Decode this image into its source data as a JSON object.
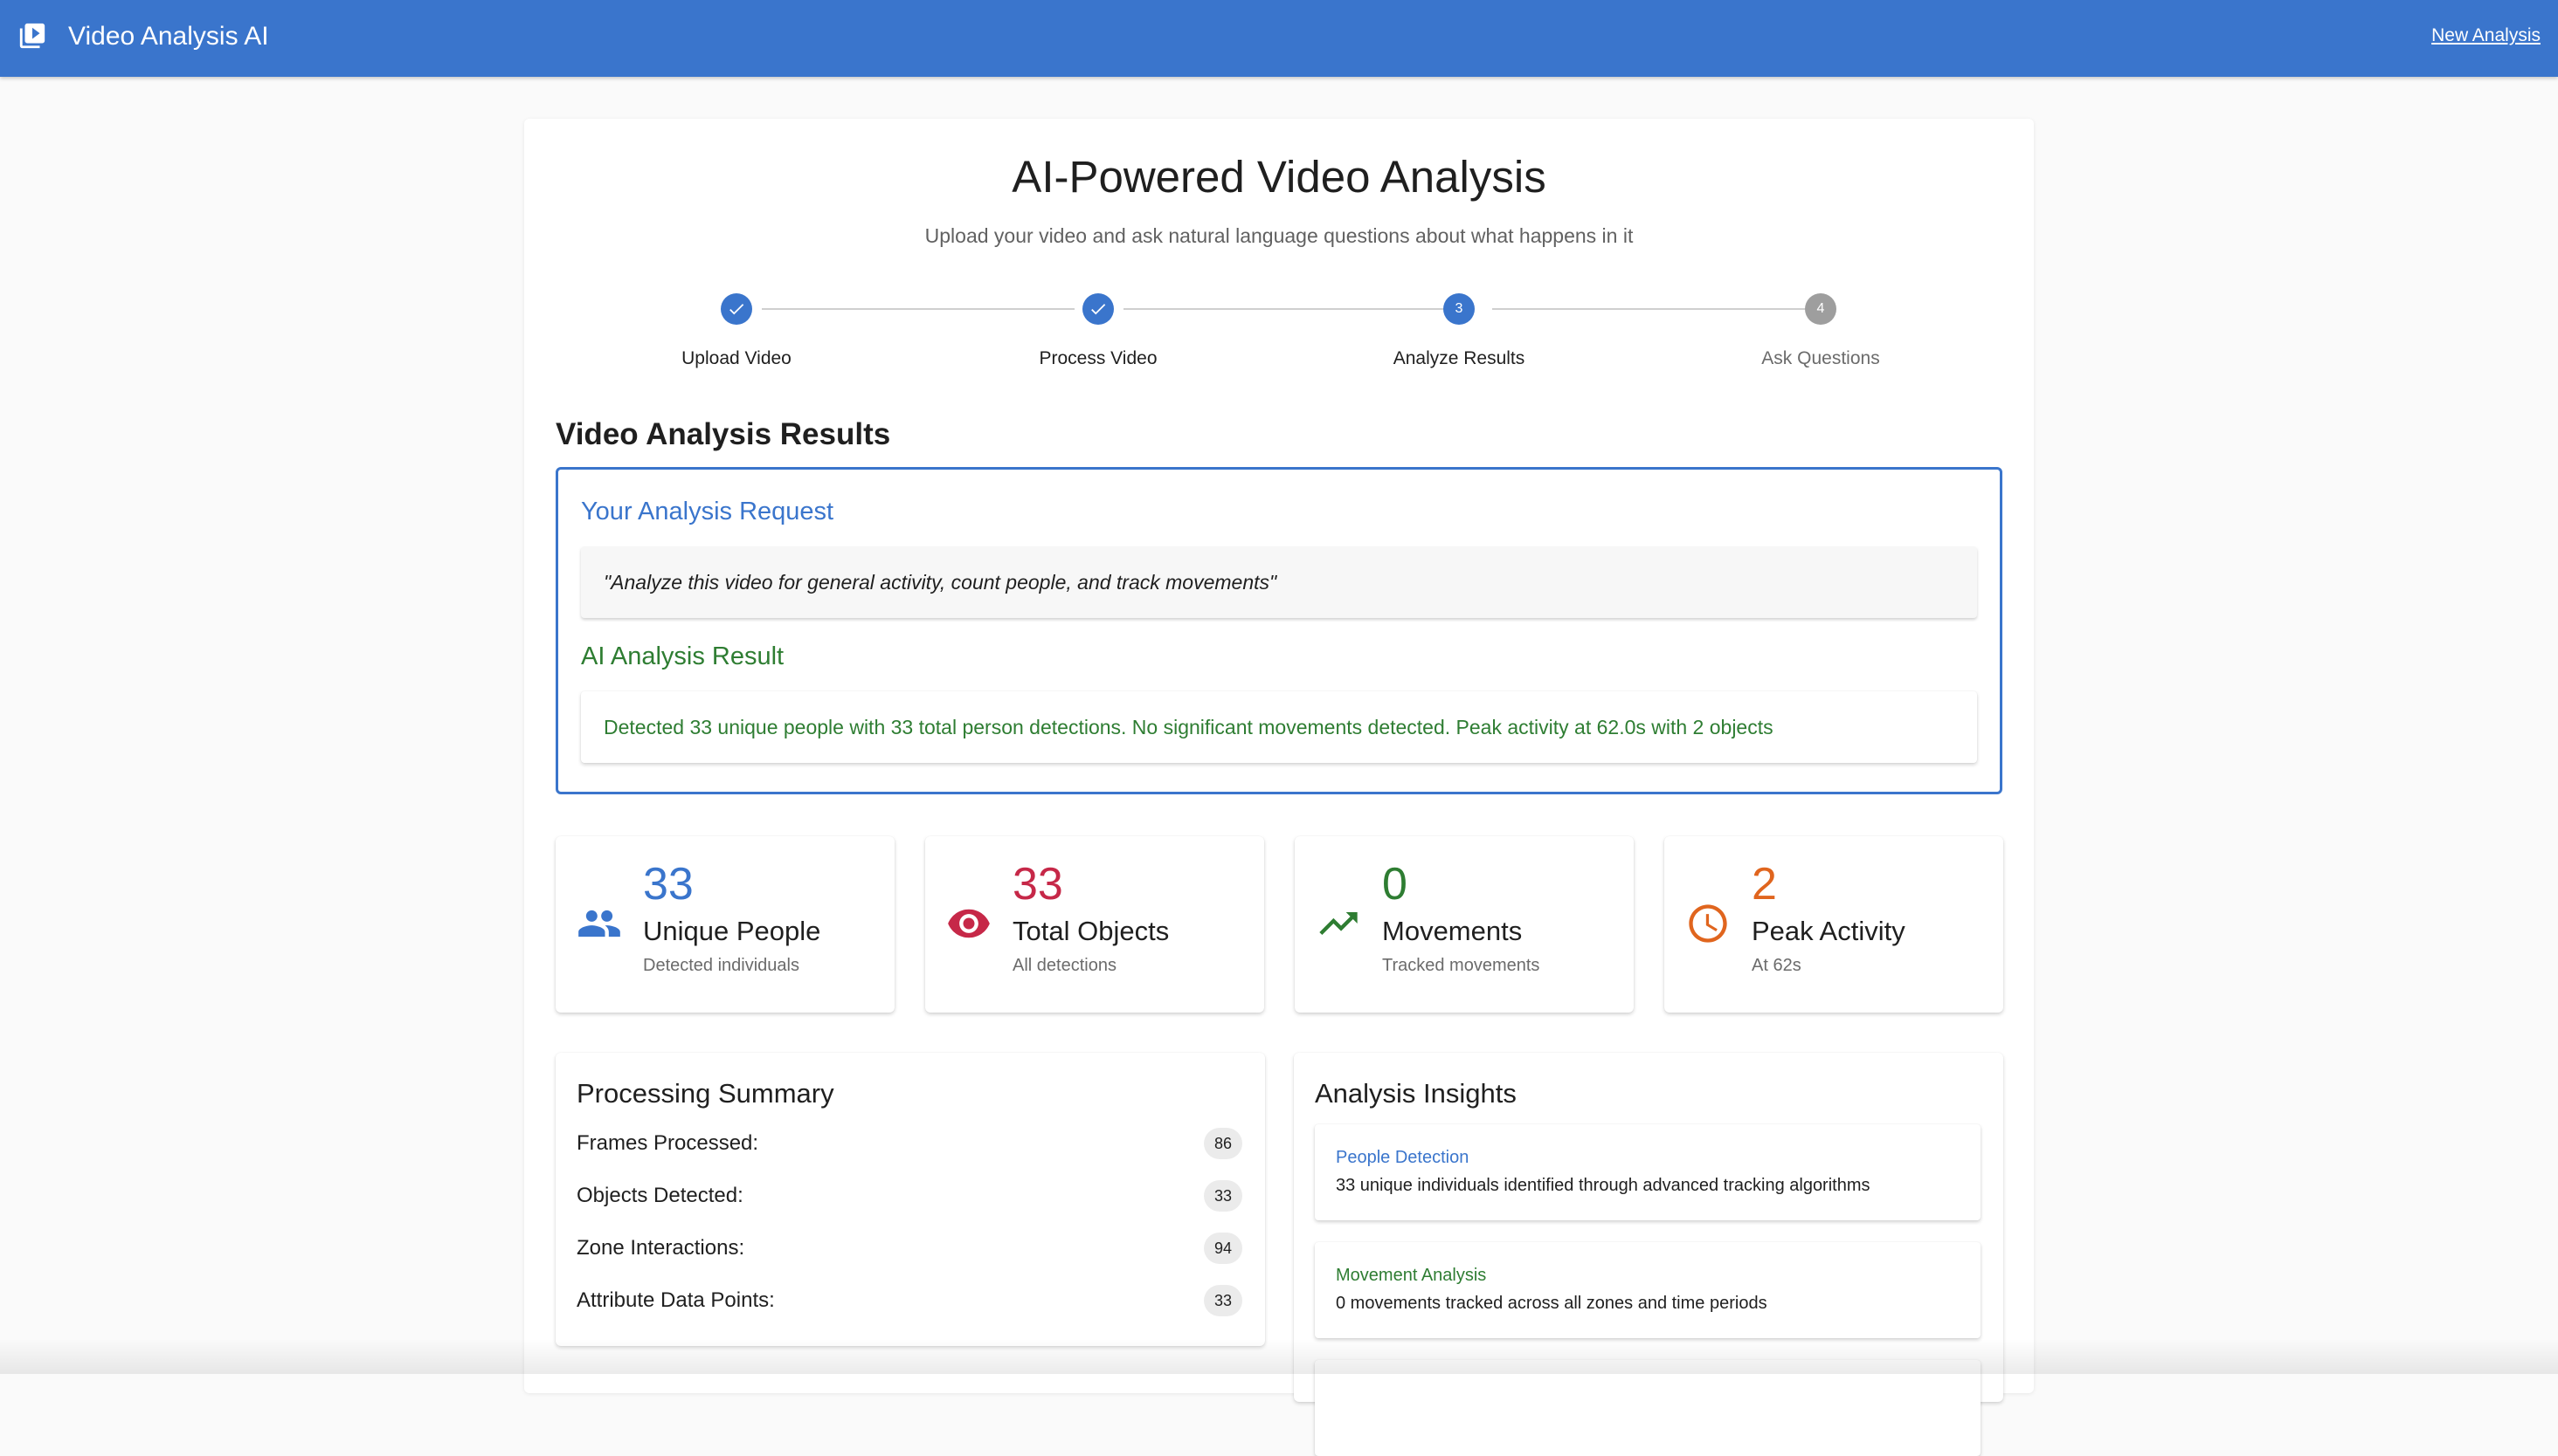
{
  "appbar": {
    "title": "Video Analysis AI",
    "new_analysis_label": "New Analysis"
  },
  "header": {
    "title": "AI-Powered Video Analysis",
    "subtitle": "Upload your video and ask natural language questions about what happens in it"
  },
  "stepper": {
    "steps": [
      {
        "label": "Upload Video",
        "state": "done",
        "number": "1"
      },
      {
        "label": "Process Video",
        "state": "done",
        "number": "2"
      },
      {
        "label": "Analyze Results",
        "state": "active",
        "number": "3"
      },
      {
        "label": "Ask Questions",
        "state": "pending",
        "number": "4"
      }
    ]
  },
  "results": {
    "title": "Video Analysis Results",
    "request_heading": "Your Analysis Request",
    "request_text": "\"Analyze this video for general activity, count people, and track movements\"",
    "result_heading": "AI Analysis Result",
    "result_text": "Detected 33 unique people with 33 total person detections. No significant movements detected. Peak activity at 62.0s with 2 objects"
  },
  "stats": [
    {
      "value": "33",
      "label": "Unique People",
      "sub": "Detected individuals",
      "icon": "people-icon",
      "color": "#3a75cc"
    },
    {
      "value": "33",
      "label": "Total Objects",
      "sub": "All detections",
      "icon": "eye-icon",
      "color": "#c62848"
    },
    {
      "value": "0",
      "label": "Movements",
      "sub": "Tracked movements",
      "icon": "trending-up-icon",
      "color": "#2e7d32"
    },
    {
      "value": "2",
      "label": "Peak Activity",
      "sub": "At 62s",
      "icon": "clock-icon",
      "color": "#e0651e"
    }
  ],
  "summary": {
    "title": "Processing Summary",
    "rows": [
      {
        "label": "Frames Processed:",
        "value": "86"
      },
      {
        "label": "Objects Detected:",
        "value": "33"
      },
      {
        "label": "Zone Interactions:",
        "value": "94"
      },
      {
        "label": "Attribute Data Points:",
        "value": "33"
      }
    ]
  },
  "insights": {
    "title": "Analysis Insights",
    "items": [
      {
        "heading": "People Detection",
        "text": "33 unique individuals identified through advanced tracking algorithms",
        "color": "#3a75cc"
      },
      {
        "heading": "Movement Analysis",
        "text": "0 movements tracked across all zones and time periods",
        "color": "#2e7d32"
      }
    ]
  }
}
